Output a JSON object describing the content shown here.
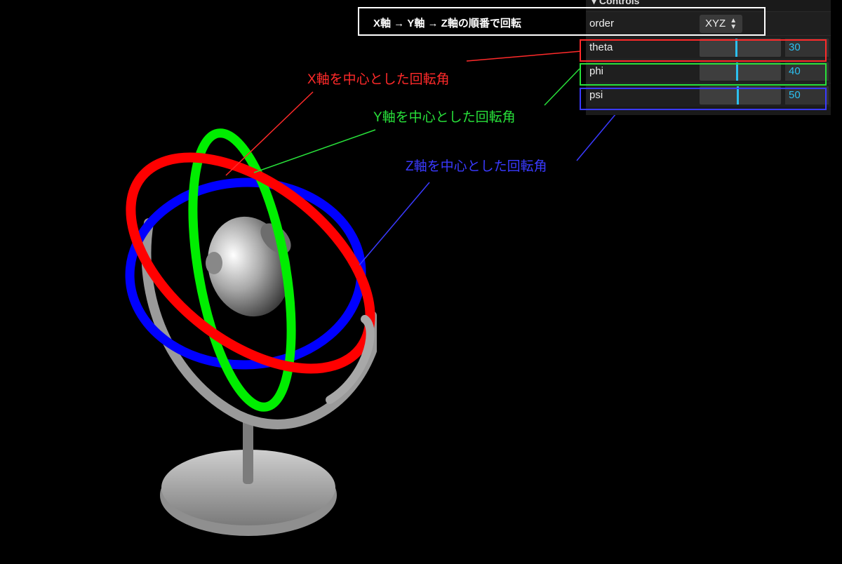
{
  "controls": {
    "title": "▾ Controls",
    "order": {
      "label": "order",
      "value": "XYZ"
    },
    "params": [
      {
        "label": "theta",
        "value": "30",
        "fraction": 0.44
      },
      {
        "label": "phi",
        "value": "40",
        "fraction": 0.45
      },
      {
        "label": "psi",
        "value": "50",
        "fraction": 0.46
      }
    ]
  },
  "annotations": {
    "order_caption": "X軸 → Y軸 → Z軸の順番で回転",
    "x_caption": "X軸を中心とした回転角",
    "y_caption": "Y軸を中心とした回転角",
    "z_caption": "Z軸を中心とした回転角"
  },
  "colors": {
    "x": "#ff2a2a",
    "y": "#28e03a",
    "z": "#3a3aff",
    "accent": "#2cc0f0"
  }
}
